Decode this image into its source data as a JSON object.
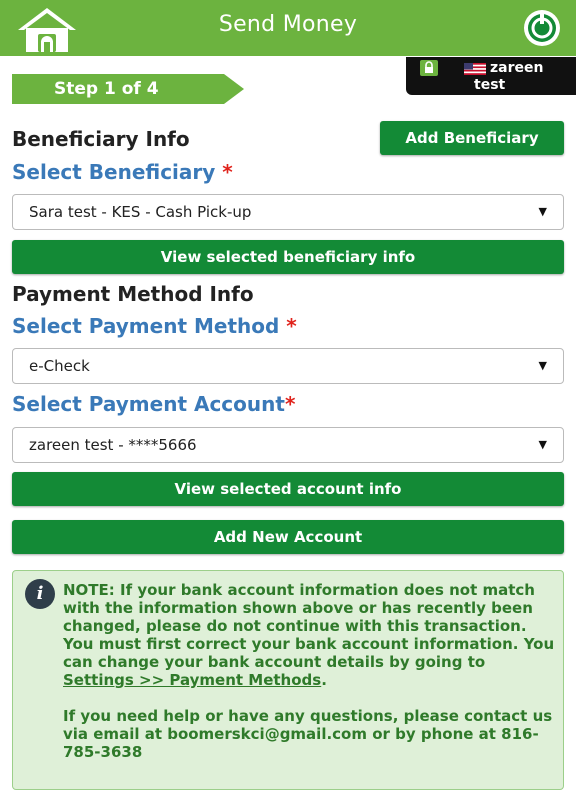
{
  "header": {
    "title": "Send Money"
  },
  "step": {
    "label": "Step 1 of 4"
  },
  "user": {
    "first": "zareen",
    "last": "test"
  },
  "beneficiary": {
    "section_title": "Beneficiary Info",
    "add_label": "Add Beneficiary",
    "select_label": "Select Beneficiary",
    "required_mark": "*",
    "selected_value": "Sara test - KES - Cash Pick-up",
    "view_label": "View selected beneficiary info"
  },
  "payment": {
    "section_title": "Payment Method Info",
    "method_label": "Select Payment Method",
    "required_mark": "*",
    "method_value": "e-Check",
    "account_label": "Select Payment Account",
    "account_value": "zareen test - ****5666",
    "view_account_label": "View selected account info",
    "add_account_label": "Add New Account"
  },
  "note": {
    "text_before_link": "NOTE: If your bank account information does not match with the information shown above or has recently been changed, please do not continue with this transaction. You must first correct your bank account information. You can change your bank account details by going to ",
    "link_text": "Settings >> Payment Methods",
    "text_after_link": ".",
    "help_text": "If you need help or have any questions, please contact us via email at boomerskci@gmail.com or by phone at 816-785-3638"
  },
  "colors": {
    "header_green": "#6cb33f",
    "button_green": "#138a36",
    "label_blue": "#3a79b8",
    "required_red": "#e0231c",
    "note_bg": "#dff0d8",
    "note_text": "#2f7a2a"
  },
  "icons": {
    "home": "home-icon",
    "logout": "power-lock-icon",
    "badge_lock": "lock-icon",
    "flag": "us-flag-icon",
    "info": "info-icon",
    "dropdown": "caret-down-icon"
  }
}
